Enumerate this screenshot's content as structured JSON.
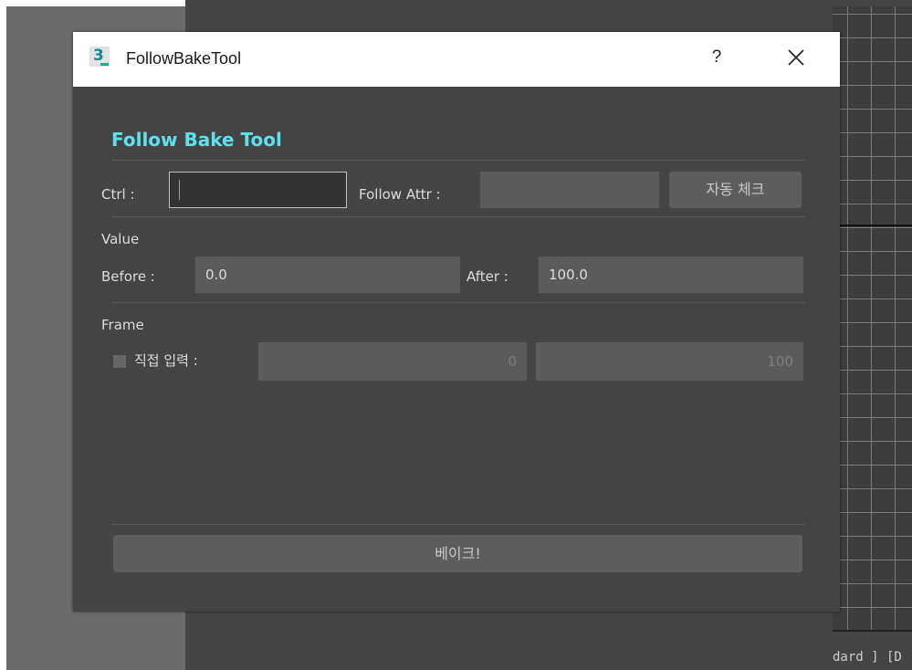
{
  "window": {
    "title": "FollowBakeTool",
    "app_icon": "3ds-max-icon",
    "help_label": "?",
    "close_icon": "close-icon"
  },
  "tool": {
    "heading": "Follow Bake Tool",
    "ctrl_label": "Ctrl :",
    "ctrl_value": "",
    "follow_attr_label": "Follow Attr :",
    "follow_attr_value": "",
    "auto_check_button": "자동 체크",
    "value_section": "Value",
    "before_label": "Before :",
    "before_value": "0.0",
    "after_label": "After :",
    "after_value": "100.0",
    "frame_section": "Frame",
    "direct_input_label": "직접 입력 :",
    "direct_input_checked": false,
    "frame_start": "0",
    "frame_end": "100",
    "bake_button": "베이크!"
  },
  "background": {
    "status_text": "dard ] [D"
  },
  "colors": {
    "heading": "#5ee0ee",
    "dialog_bg": "#444444",
    "field_bg": "#5b5b5b"
  }
}
